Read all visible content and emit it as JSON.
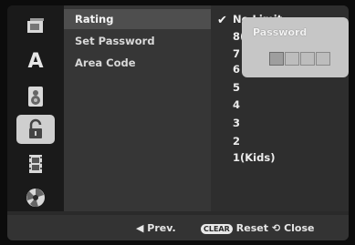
{
  "menu": {
    "items": [
      {
        "label": "Rating",
        "selected": true
      },
      {
        "label": "Set Password",
        "selected": false
      },
      {
        "label": "Area Code",
        "selected": false
      }
    ]
  },
  "options": {
    "items": [
      "No Limit",
      "8(Adult)",
      "7",
      "6",
      "5",
      "4",
      "3",
      "2",
      "1(Kids)"
    ],
    "checked": "No Limit"
  },
  "sidebar": {
    "icons": [
      {
        "name": "disc-menu-icon"
      },
      {
        "name": "language-icon",
        "glyph": "A"
      },
      {
        "name": "audio-icon"
      },
      {
        "name": "lock-icon",
        "active": true
      },
      {
        "name": "film-icon"
      },
      {
        "name": "others-icon"
      }
    ]
  },
  "popup": {
    "title": "Password",
    "digit_count": 4
  },
  "bottom": {
    "prev": "◀ Prev.",
    "clear_badge": "CLEAR",
    "reset": "Reset",
    "close_glyph": "⟲",
    "close": "Close"
  }
}
